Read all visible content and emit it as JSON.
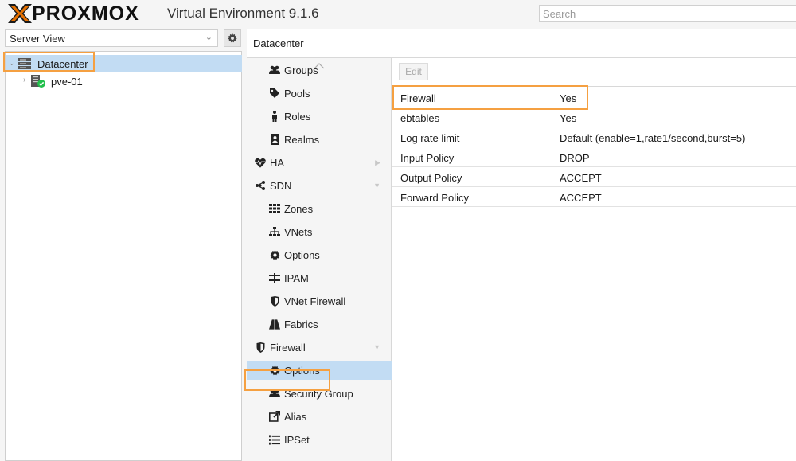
{
  "header": {
    "logo_text": "PROXMOX",
    "version": "Virtual Environment 9.1.6",
    "search_placeholder": "Search"
  },
  "sidebar": {
    "view_label": "Server View",
    "tree": [
      {
        "label": "Datacenter",
        "icon": "datacenter-icon",
        "selected": true
      },
      {
        "label": "pve-01",
        "icon": "node-online-icon",
        "selected": false
      }
    ]
  },
  "main": {
    "title": "Datacenter",
    "nav": [
      {
        "label": "Groups",
        "icon": "users-icon",
        "level": 1
      },
      {
        "label": "Pools",
        "icon": "tags-icon",
        "level": 1
      },
      {
        "label": "Roles",
        "icon": "male-icon",
        "level": 1
      },
      {
        "label": "Realms",
        "icon": "address-book-icon",
        "level": 1
      },
      {
        "label": "HA",
        "icon": "heartbeat-icon",
        "level": 0,
        "expandable": "right"
      },
      {
        "label": "SDN",
        "icon": "sdn-icon",
        "level": 0,
        "expandable": "down"
      },
      {
        "label": "Zones",
        "icon": "th-icon",
        "level": 1
      },
      {
        "label": "VNets",
        "icon": "sitemap-icon",
        "level": 1
      },
      {
        "label": "Options",
        "icon": "gear-icon",
        "level": 1
      },
      {
        "label": "IPAM",
        "icon": "ipam-icon",
        "level": 1
      },
      {
        "label": "VNet Firewall",
        "icon": "shield-icon",
        "level": 1
      },
      {
        "label": "Fabrics",
        "icon": "road-icon",
        "level": 1
      },
      {
        "label": "Firewall",
        "icon": "shield-icon",
        "level": 0,
        "expandable": "down"
      },
      {
        "label": "Options",
        "icon": "gear-icon",
        "level": 1,
        "selected": true
      },
      {
        "label": "Security Group",
        "icon": "users-icon",
        "level": 1
      },
      {
        "label": "Alias",
        "icon": "external-link-icon",
        "level": 1
      },
      {
        "label": "IPSet",
        "icon": "list-ol-icon",
        "level": 1
      }
    ],
    "toolbar": {
      "edit_label": "Edit"
    },
    "grid": [
      {
        "key": "Firewall",
        "value": "Yes"
      },
      {
        "key": "ebtables",
        "value": "Yes"
      },
      {
        "key": "Log rate limit",
        "value": "Default (enable=1,rate1/second,burst=5)"
      },
      {
        "key": "Input Policy",
        "value": "DROP"
      },
      {
        "key": "Output Policy",
        "value": "ACCEPT"
      },
      {
        "key": "Forward Policy",
        "value": "ACCEPT"
      }
    ]
  },
  "colors": {
    "selection": "#c2dcf3",
    "highlight": "#f5a041",
    "logo_orange": "#e57000",
    "status_ok": "#21bf4b"
  }
}
